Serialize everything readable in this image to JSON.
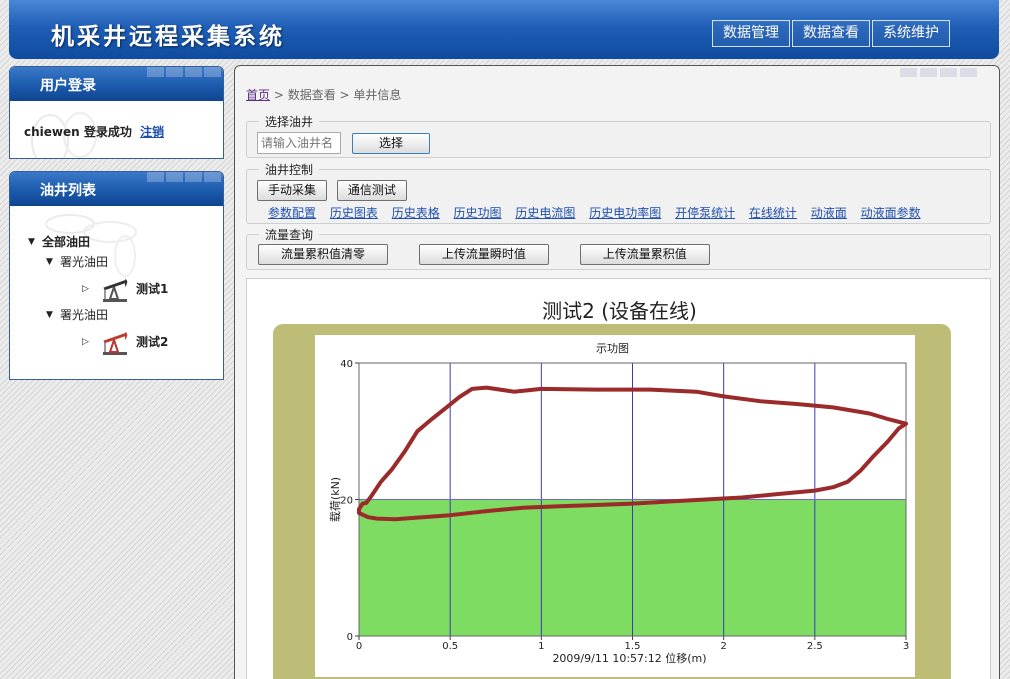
{
  "app": {
    "title": "机采井远程采集系统"
  },
  "topnav": [
    "数据管理",
    "数据查看",
    "系统维护"
  ],
  "login_panel": {
    "title": "用户登录",
    "username": "chiewen",
    "status": "登录成功",
    "logout": "注销"
  },
  "well_panel": {
    "title": "油井列表",
    "root": "全部油田",
    "fields": [
      {
        "name": "署光油田",
        "well": "测试1"
      },
      {
        "name": "署光油田",
        "well": "测试2"
      }
    ]
  },
  "breadcrumb": {
    "home": "首页",
    "sep1": " > ",
    "level2": "数据查看",
    "sep2": " > ",
    "level3": "单井信息"
  },
  "select_well": {
    "legend": "选择油井",
    "placeholder": "请输入油井名",
    "button": "选择"
  },
  "well_control": {
    "legend": "油井控制",
    "buttons": [
      "手动采集",
      "通信测试"
    ],
    "links": [
      "参数配置",
      "历史图表",
      "历史表格",
      "历史功图",
      "历史电流图",
      "历史电功率图",
      "开停泵统计",
      "在线统计",
      "动液面",
      "动液面参数"
    ]
  },
  "flow_query": {
    "legend": "流量查询",
    "buttons": [
      "流量累积值清零",
      "上传流量瞬时值",
      "上传流量累积值"
    ]
  },
  "chart_heading": "测试2 (设备在线)",
  "chart_data": {
    "type": "line",
    "title": "示功图",
    "xlabel": "2009/9/11 10:57:12  位移(m)",
    "ylabel": "载荷(kN)",
    "xlim": [
      0,
      3
    ],
    "ylim": [
      0,
      40
    ],
    "xticks": [
      "0",
      "0.5",
      "1",
      "1.5",
      "2",
      "2.5",
      "3"
    ],
    "yticks": [
      "0",
      "20",
      "40"
    ],
    "band": {
      "from": 0,
      "to": 20,
      "color": "#7fdc62"
    },
    "grid": true,
    "line_color": "#9b2a2a",
    "series": [
      {
        "points": [
          [
            0,
            18.0
          ],
          [
            0.05,
            17.4
          ],
          [
            0.1,
            17.2
          ],
          [
            0.2,
            17.1
          ],
          [
            0.3,
            17.3
          ],
          [
            0.5,
            17.7
          ],
          [
            0.7,
            18.3
          ],
          [
            0.9,
            18.8
          ],
          [
            1.1,
            19.0
          ],
          [
            1.3,
            19.2
          ],
          [
            1.5,
            19.4
          ],
          [
            1.7,
            19.7
          ],
          [
            1.9,
            20.0
          ],
          [
            2.1,
            20.3
          ],
          [
            2.3,
            20.8
          ],
          [
            2.5,
            21.3
          ],
          [
            2.6,
            21.8
          ],
          [
            2.68,
            22.6
          ],
          [
            2.75,
            24.2
          ],
          [
            2.82,
            26.3
          ],
          [
            2.9,
            28.5
          ],
          [
            2.96,
            30.4
          ],
          [
            3.0,
            31.1
          ],
          [
            2.9,
            31.8
          ],
          [
            2.8,
            32.6
          ],
          [
            2.6,
            33.5
          ],
          [
            2.4,
            34.0
          ],
          [
            2.2,
            34.4
          ],
          [
            2.0,
            35.1
          ],
          [
            1.85,
            35.8
          ],
          [
            1.6,
            36.1
          ],
          [
            1.3,
            36.1
          ],
          [
            1.0,
            36.2
          ],
          [
            0.85,
            35.8
          ],
          [
            0.7,
            36.4
          ],
          [
            0.62,
            36.2
          ],
          [
            0.55,
            35.0
          ],
          [
            0.48,
            33.5
          ],
          [
            0.4,
            31.8
          ],
          [
            0.32,
            30.0
          ],
          [
            0.25,
            27.0
          ],
          [
            0.18,
            24.4
          ],
          [
            0.12,
            22.6
          ],
          [
            0.07,
            20.6
          ],
          [
            0.04,
            19.5
          ],
          [
            0.02,
            19.4
          ],
          [
            0,
            18.6
          ]
        ]
      }
    ]
  }
}
